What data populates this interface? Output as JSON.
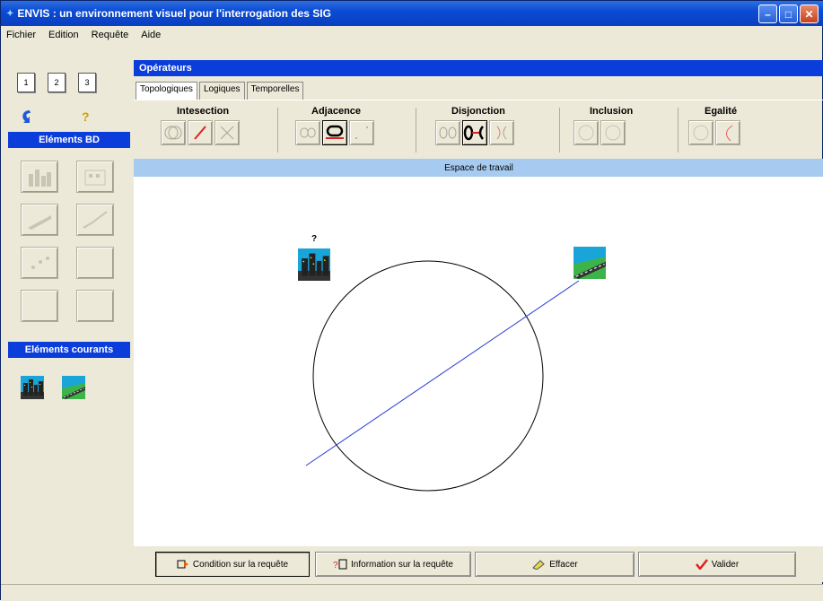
{
  "window": {
    "title": "ENVIS : un environnement visuel pour l'interrogation des SIG"
  },
  "menu": {
    "items": [
      "Fichier",
      "Edition",
      "Requête",
      "Aide"
    ]
  },
  "left": {
    "docs": [
      "1",
      "2",
      "3"
    ],
    "help_label": "?",
    "elements_bd_title": "Eléments BD",
    "current_title": "Eléments courants"
  },
  "operators": {
    "title": "Opérateurs",
    "tabs": [
      "Topologiques",
      "Logiques",
      "Temporelles"
    ],
    "groups": [
      "Intesection",
      "Adjacence",
      "Disjonction",
      "Inclusion",
      "Egalité"
    ]
  },
  "workspace": {
    "title": "Espace de travail",
    "question_mark": "?",
    "circle_color": "#000000",
    "line_color": "#2b3fd6"
  },
  "actions": {
    "condition": "Condition sur la requête",
    "information": "Information sur la requête",
    "effacer": "Effacer",
    "valider": "Valider"
  },
  "colors": {
    "title_bar": "#0b4bd4",
    "panel_header": "#0b3ddb",
    "workspace_header": "#a6caf0"
  }
}
